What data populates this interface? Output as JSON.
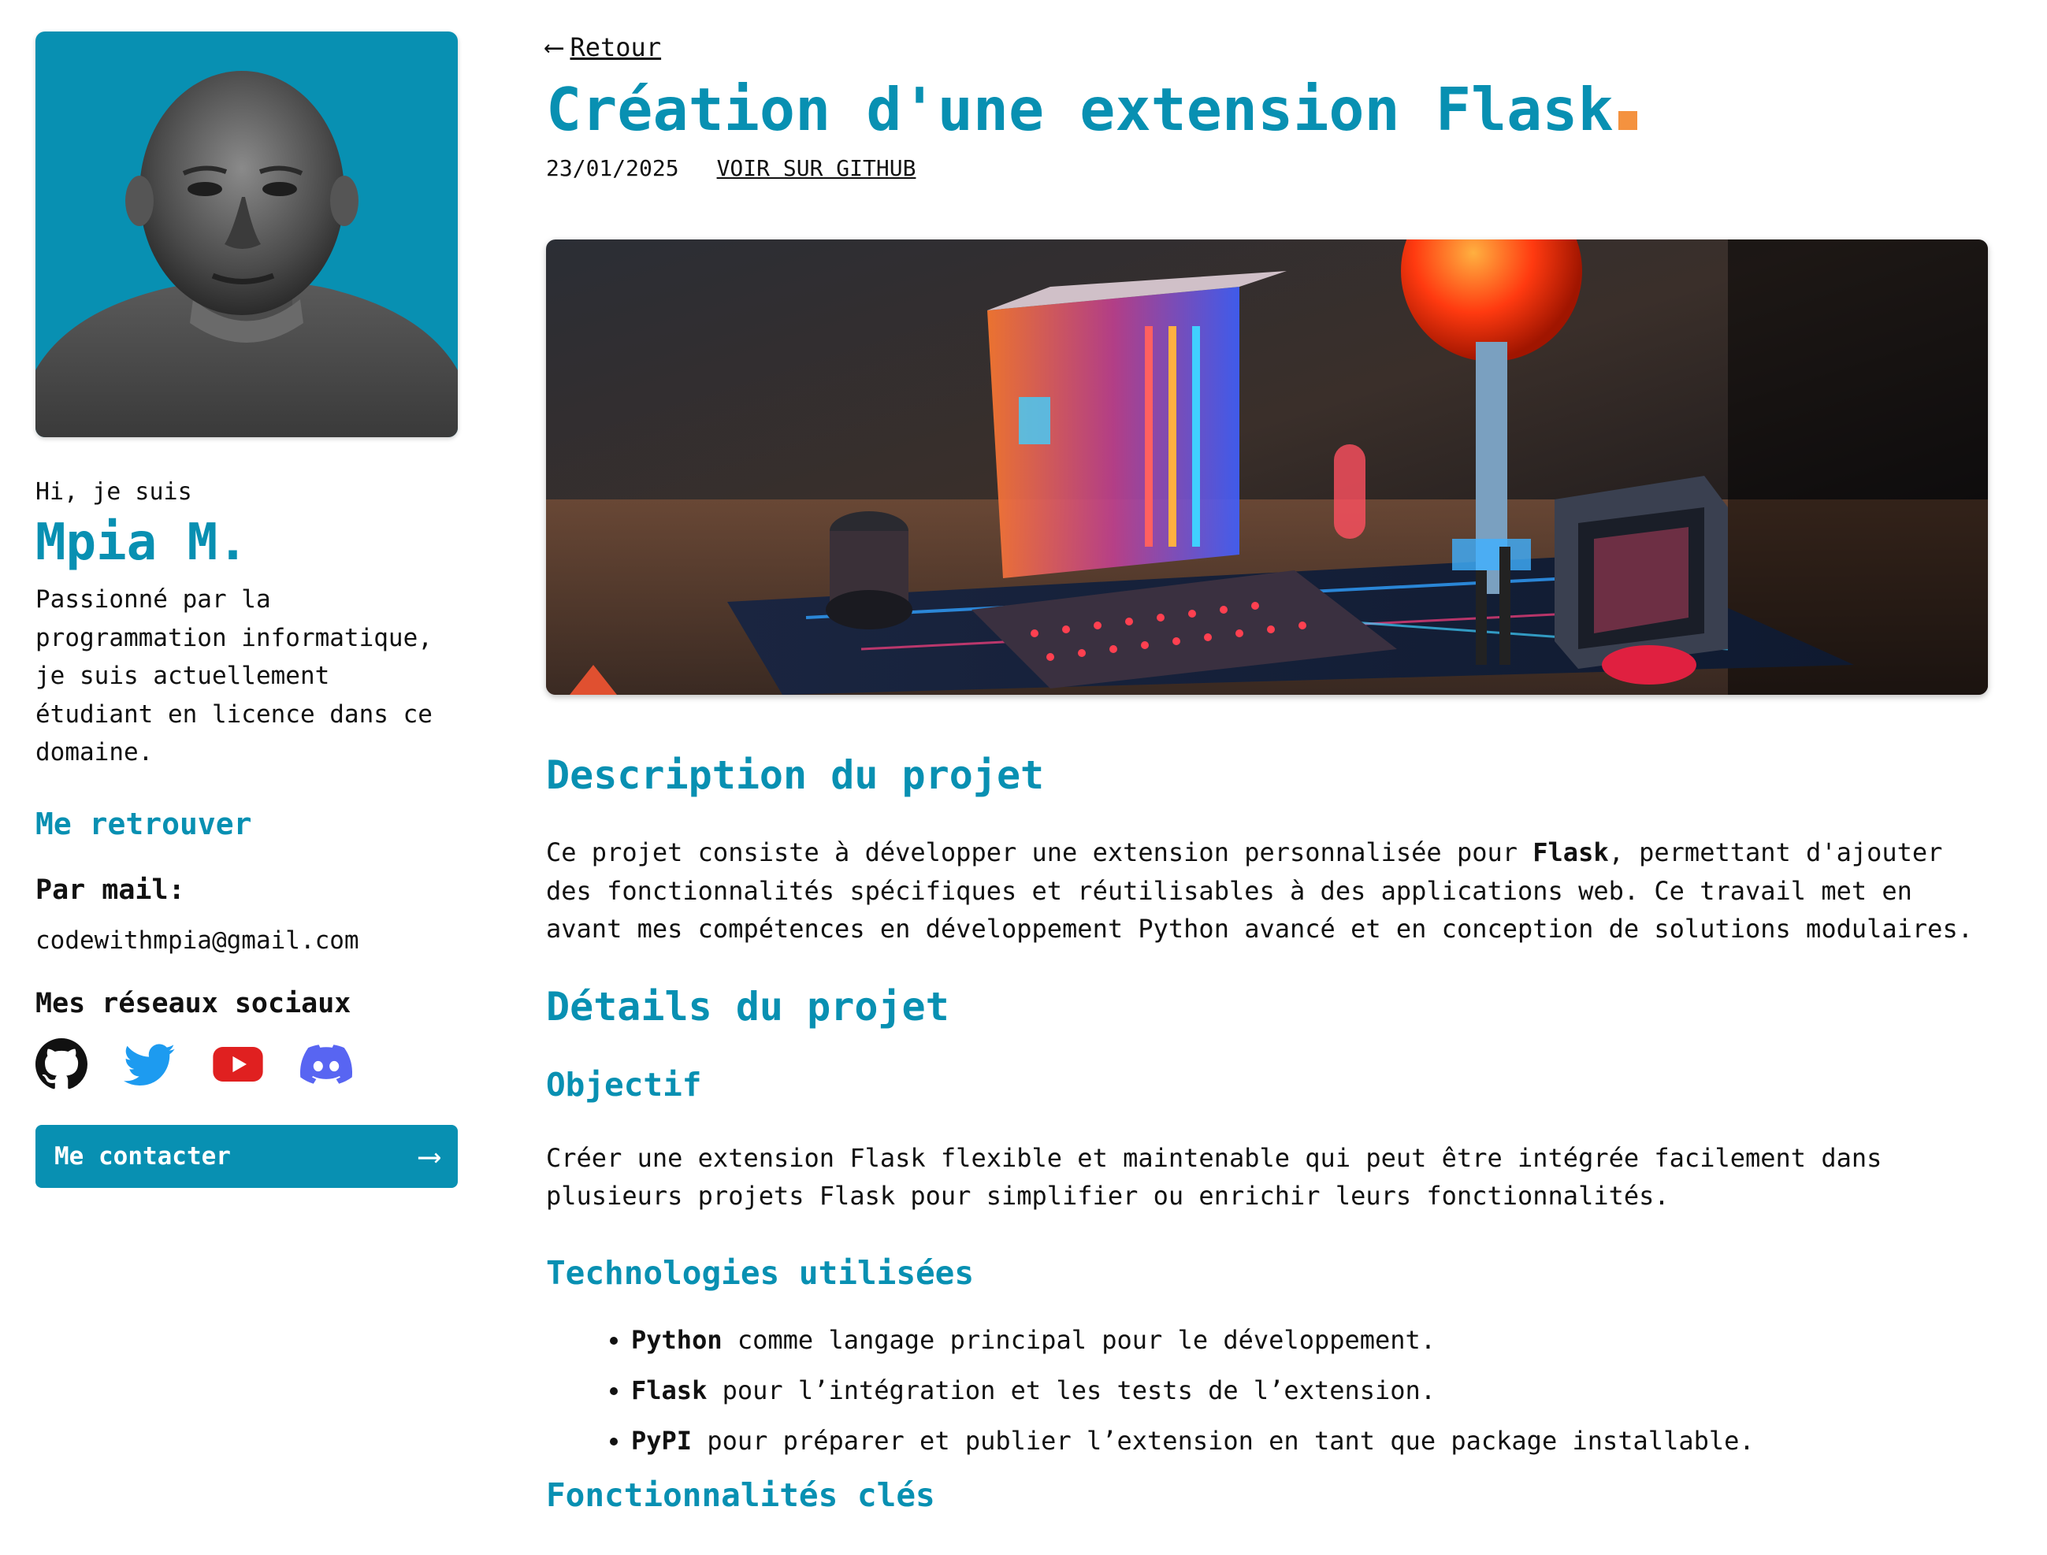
{
  "sidebar": {
    "greeting": "Hi, je suis",
    "name": "Mpia M.",
    "bio": "Passionné par la programmation informatique, je suis actuellement étudiant en licence dans ce domaine.",
    "find_me": "Me retrouver",
    "mail_label": "Par mail:",
    "mail_value": "codewithmpia@gmail.com",
    "social_heading": "Mes réseaux sociaux",
    "socials": [
      "github-icon",
      "twitter-icon",
      "youtube-icon",
      "discord-icon"
    ],
    "contact_label": "Me contacter",
    "contact_arrow": "⟶"
  },
  "main": {
    "back_arrow": "⟵",
    "back_label": "Retour",
    "title": "Création d'une extension Flask",
    "date": "23/01/2025",
    "github_link": "VOIR SUR GITHUB",
    "description_title": "Description du projet",
    "description_pre": "Ce projet consiste à développer une extension personnalisée pour ",
    "description_bold": "Flask",
    "description_post": ", permettant d'ajouter des fonctionnalités spécifiques et réutilisables à des applications web. Ce travail met en avant mes compétences en développement Python avancé et en conception de solutions modulaires.",
    "details_title": "Détails du projet",
    "objective_title": "Objectif",
    "objective_text": "Créer une extension Flask flexible et maintenable qui peut être intégrée facilement dans plusieurs projets Flask pour simplifier ou enrichir leurs fonctionnalités.",
    "tech_title": "Technologies utilisées",
    "techs": [
      {
        "name": "Python",
        "desc": " comme langage principal pour le développement."
      },
      {
        "name": "Flask",
        "desc": " pour l’intégration et les tests de l’extension."
      },
      {
        "name": "PyPI",
        "desc": " pour préparer et publier l’extension en tant que package installable."
      }
    ],
    "next_section_title": "Fonctionnalités clés"
  },
  "colors": {
    "accent": "#0890b2",
    "cursor": "#f4923f",
    "text": "#111111"
  }
}
